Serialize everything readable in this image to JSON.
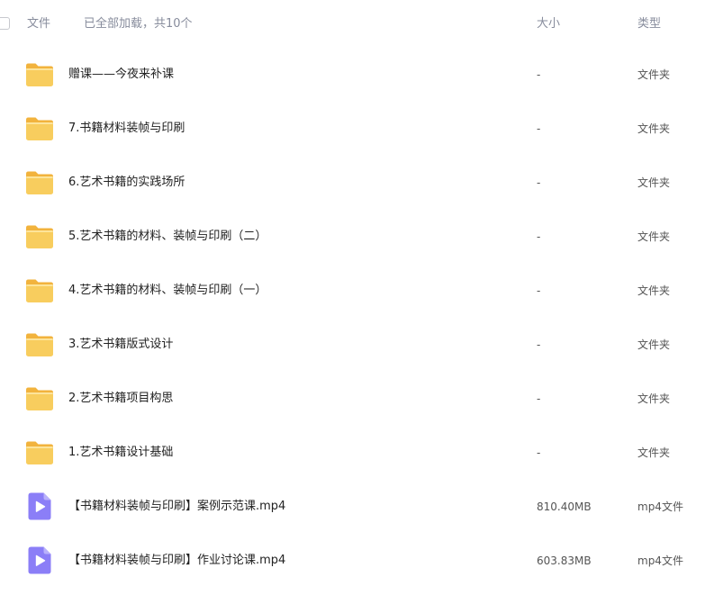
{
  "header": {
    "name_label": "文件",
    "status_label": "已全部加载，共10个",
    "size_label": "大小",
    "type_label": "类型"
  },
  "icons": {
    "folder": "folder-icon",
    "video": "video-file-icon"
  },
  "colors": {
    "folder": "#f8cd5e",
    "video": "#8b7ef7"
  },
  "files": [
    {
      "name": "赠课——今夜来补课",
      "size": "-",
      "type": "文件夹",
      "kind": "folder"
    },
    {
      "name": "7.书籍材料装帧与印刷",
      "size": "-",
      "type": "文件夹",
      "kind": "folder"
    },
    {
      "name": "6.艺术书籍的实践场所",
      "size": "-",
      "type": "文件夹",
      "kind": "folder"
    },
    {
      "name": "5.艺术书籍的材料、装帧与印刷（二）",
      "size": "-",
      "type": "文件夹",
      "kind": "folder"
    },
    {
      "name": "4.艺术书籍的材料、装帧与印刷（一）",
      "size": "-",
      "type": "文件夹",
      "kind": "folder"
    },
    {
      "name": "3.艺术书籍版式设计",
      "size": "-",
      "type": "文件夹",
      "kind": "folder"
    },
    {
      "name": "2.艺术书籍项目构思",
      "size": "-",
      "type": "文件夹",
      "kind": "folder"
    },
    {
      "name": "1.艺术书籍设计基础",
      "size": "-",
      "type": "文件夹",
      "kind": "folder"
    },
    {
      "name": "【书籍材料装帧与印刷】案例示范课.mp4",
      "size": "810.40MB",
      "type": "mp4文件",
      "kind": "video"
    },
    {
      "name": "【书籍材料装帧与印刷】作业讨论课.mp4",
      "size": "603.83MB",
      "type": "mp4文件",
      "kind": "video"
    }
  ]
}
